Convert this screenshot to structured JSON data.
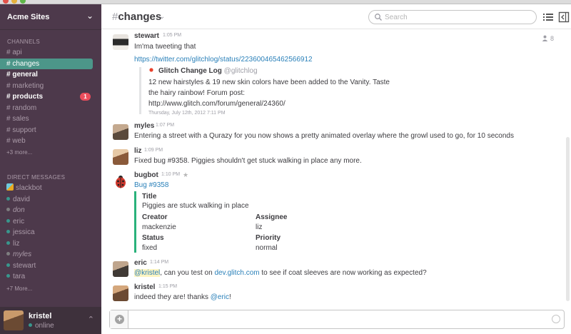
{
  "team": {
    "name": "Acme Sites"
  },
  "sidebar": {
    "channels_heading": "CHANNELS",
    "channels": [
      {
        "label": "# api",
        "state": "normal"
      },
      {
        "label": "# changes",
        "state": "active"
      },
      {
        "label": "# general",
        "state": "unread"
      },
      {
        "label": "# marketing",
        "state": "normal"
      },
      {
        "label": "# products",
        "state": "unread",
        "badge": "1"
      },
      {
        "label": "# random",
        "state": "normal"
      },
      {
        "label": "# sales",
        "state": "normal"
      },
      {
        "label": "# support",
        "state": "normal"
      },
      {
        "label": "# web",
        "state": "normal"
      }
    ],
    "channels_more": "+3 more...",
    "dm_heading": "DIRECT MESSAGES",
    "dms": [
      {
        "name": "slackbot",
        "presence": "bot"
      },
      {
        "name": "david",
        "presence": "online"
      },
      {
        "name": "don",
        "presence": "away"
      },
      {
        "name": "eric",
        "presence": "online"
      },
      {
        "name": "jessica",
        "presence": "online"
      },
      {
        "name": "liz",
        "presence": "online"
      },
      {
        "name": "myles",
        "presence": "away"
      },
      {
        "name": "stewart",
        "presence": "online"
      },
      {
        "name": "tara",
        "presence": "online"
      }
    ],
    "dm_more": "+7 More...",
    "user": {
      "name": "kristel",
      "status": "online"
    }
  },
  "header": {
    "channel_hash": "#",
    "channel_name": "changes",
    "search_placeholder": "Search",
    "member_count": "8"
  },
  "messages": [
    {
      "author": "stewart",
      "time": "1:05 PM",
      "text": "Im'ma tweeting that",
      "link": "https://twitter.com/glitchlog/status/223600465462566912",
      "attachment": {
        "source_name": "Glitch Change Log",
        "source_handle": "@glitchlog",
        "line1": "12 new hairstyles & 19 new skin colors have been added to the Vanity. Taste",
        "line2": "the hairy rainbow! Forum post:",
        "link": "http://www.glitch.com/forum/general/24360/",
        "date": "Thursday, July 12th, 2012 7:11 PM"
      }
    },
    {
      "author": "myles",
      "time": "1:07 PM",
      "text": "Entering a street with a Qurazy for you now shows a pretty animated overlay where the growl used to go, for 10 seconds"
    },
    {
      "author": "liz",
      "time": "1:09 PM",
      "text": "Fixed bug #9358. Piggies shouldn't get stuck walking in place any more."
    },
    {
      "author": "bugbot",
      "time": "1:10 PM",
      "link": "Bug #9358",
      "fields": {
        "title_label": "Title",
        "title_value": "Piggies are stuck walking in place",
        "creator_label": "Creator",
        "creator_value": "mackenzie",
        "assignee_label": "Assignee",
        "assignee_value": "liz",
        "status_label": "Status",
        "status_value": "fixed",
        "priority_label": "Priority",
        "priority_value": "normal"
      }
    },
    {
      "author": "eric",
      "time": "1:14 PM",
      "mention": "@kristel",
      "text_a": ", can you test on ",
      "link": "dev.glitch.com",
      "text_b": " to see if coat sleeves are now working as expected?"
    },
    {
      "author": "kristel",
      "time": "1:15 PM",
      "text": "indeed they are! thanks ",
      "mention": "@eric",
      "text_after": "!"
    }
  ],
  "colors": {
    "sidebar": "#4d394b",
    "active_channel": "#4c9689",
    "badge": "#eb4d5c",
    "link": "#2a80b9",
    "bug_border": "#2ab27b"
  },
  "icons": [
    "search-icon",
    "channel-list-icon",
    "sidebar-toggle-icon",
    "members-icon",
    "star-icon",
    "plus-icon",
    "emoji-icon",
    "chevron-down-icon",
    "chevron-up-icon"
  ]
}
